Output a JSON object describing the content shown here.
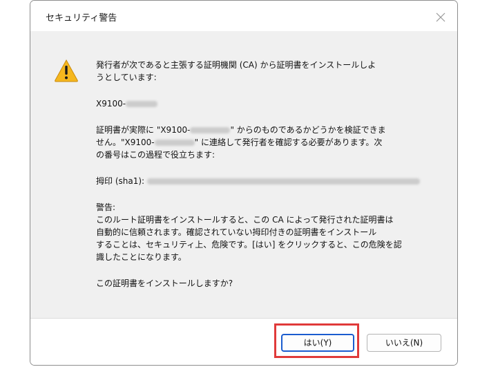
{
  "window": {
    "title": "セキュリティ警告"
  },
  "icons": {
    "warning": "warning-icon",
    "close": "close-icon"
  },
  "message": {
    "intro_line1": "発行者が次であると主張する証明機関 (CA) から証明書をインストールしよ",
    "intro_line2": "うとしています:",
    "issuer_prefix": "X9100-",
    "verify_line1_a": "証明書が実際に \"X9100-",
    "verify_line1_b": "\" からのものであるかどうかを検証できま",
    "verify_line2_a": "せん。\"X9100-",
    "verify_line2_b": "\" に連絡して発行者を確認する必要があります。次",
    "verify_line3": "の番号はこの過程で役立ちます:",
    "thumbprint_label": "拇印 (sha1):",
    "warning_heading": "警告:",
    "warning_line1": "このルート証明書をインストールすると、この CA によって発行された証明書は",
    "warning_line2": "自動的に信頼されます。確認されていない拇印付きの証明書をインストール",
    "warning_line3": "することは、セキュリティ上、危険です。[はい] をクリックすると、この危険を認",
    "warning_line4": "識したことになります。",
    "question": "この証明書をインストールしますか?"
  },
  "buttons": {
    "yes": "はい(Y)",
    "no": "いいえ(N)"
  },
  "colors": {
    "highlight": "#e03a3a",
    "focus_border": "#1a5ccf",
    "warning_fill": "#f5b71e",
    "content_bg": "#f0f0f0"
  }
}
